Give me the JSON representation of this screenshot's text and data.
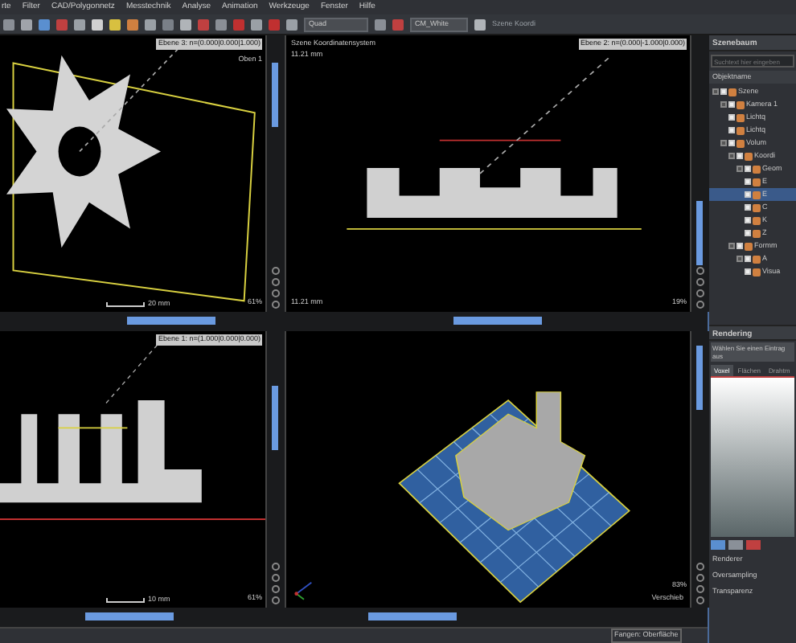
{
  "menu": [
    "rte",
    "Filter",
    "CAD/Polygonnetz",
    "Messtechnik",
    "Analyse",
    "Animation",
    "Werkzeuge",
    "Fenster",
    "Hilfe"
  ],
  "toolbar": {
    "layout": "Quad",
    "color_scheme": "CM_White",
    "coordinate_system": "Szene Koordi"
  },
  "viewports": [
    {
      "kind": "gear",
      "plane": "Ebene 3: n=(0.000|0.000|1.000)",
      "view": "Oben 1",
      "scale": "20 mm",
      "zoom": "61%"
    },
    {
      "kind": "profile",
      "plane": "Ebene 2: n=(0.000|-1.000|0.000)",
      "system": "Szene Koordinatensystem",
      "size": "11.21 mm",
      "size_bottom": "11.21 mm",
      "zoom": "19%"
    },
    {
      "kind": "comb",
      "plane": "Ebene 1: n=(1.000|0.000|0.000)",
      "scale": "10 mm",
      "zoom": "61%"
    },
    {
      "kind": "render3d",
      "mode": "Verschieb",
      "zoom": "83%"
    }
  ],
  "scene_tree": {
    "title": "Szenebaum",
    "search_placeholder": "Suchtext hier eingeben",
    "column": "Objektname",
    "items": [
      {
        "label": "Szene",
        "expanded": true,
        "children": [
          {
            "label": "Kamera 1",
            "expanded": true,
            "children": [
              {
                "label": "Lichtq"
              },
              {
                "label": "Lichtq"
              }
            ]
          },
          {
            "label": "Volum",
            "expanded": true,
            "children": [
              {
                "label": "Koordi",
                "expanded": true,
                "children": [
                  {
                    "label": "Geom",
                    "expanded": true,
                    "children": [
                      {
                        "label": "E",
                        "selected": false
                      },
                      {
                        "label": "E",
                        "selected": true
                      },
                      {
                        "label": "C",
                        "selected": false
                      },
                      {
                        "label": "K",
                        "selected": false
                      },
                      {
                        "label": "Z",
                        "selected": false
                      }
                    ]
                  }
                ]
              },
              {
                "label": "Formm",
                "expanded": true,
                "children": [
                  {
                    "label": "A",
                    "expanded": true,
                    "children": [
                      {
                        "label": "Visua"
                      }
                    ]
                  }
                ]
              }
            ]
          }
        ]
      }
    ]
  },
  "rendering": {
    "title": "Rendering",
    "hint": "Wählen Sie einen Eintrag aus",
    "tabs": [
      {
        "label": "Voxel",
        "selected": true
      },
      {
        "label": "Flächen",
        "selected": false
      },
      {
        "label": "Drahtm",
        "selected": false
      }
    ],
    "properties": [
      "Renderer",
      "Oversampling",
      "Transparenz"
    ]
  },
  "status": {
    "snap": "Fangen: Oberfläche"
  }
}
